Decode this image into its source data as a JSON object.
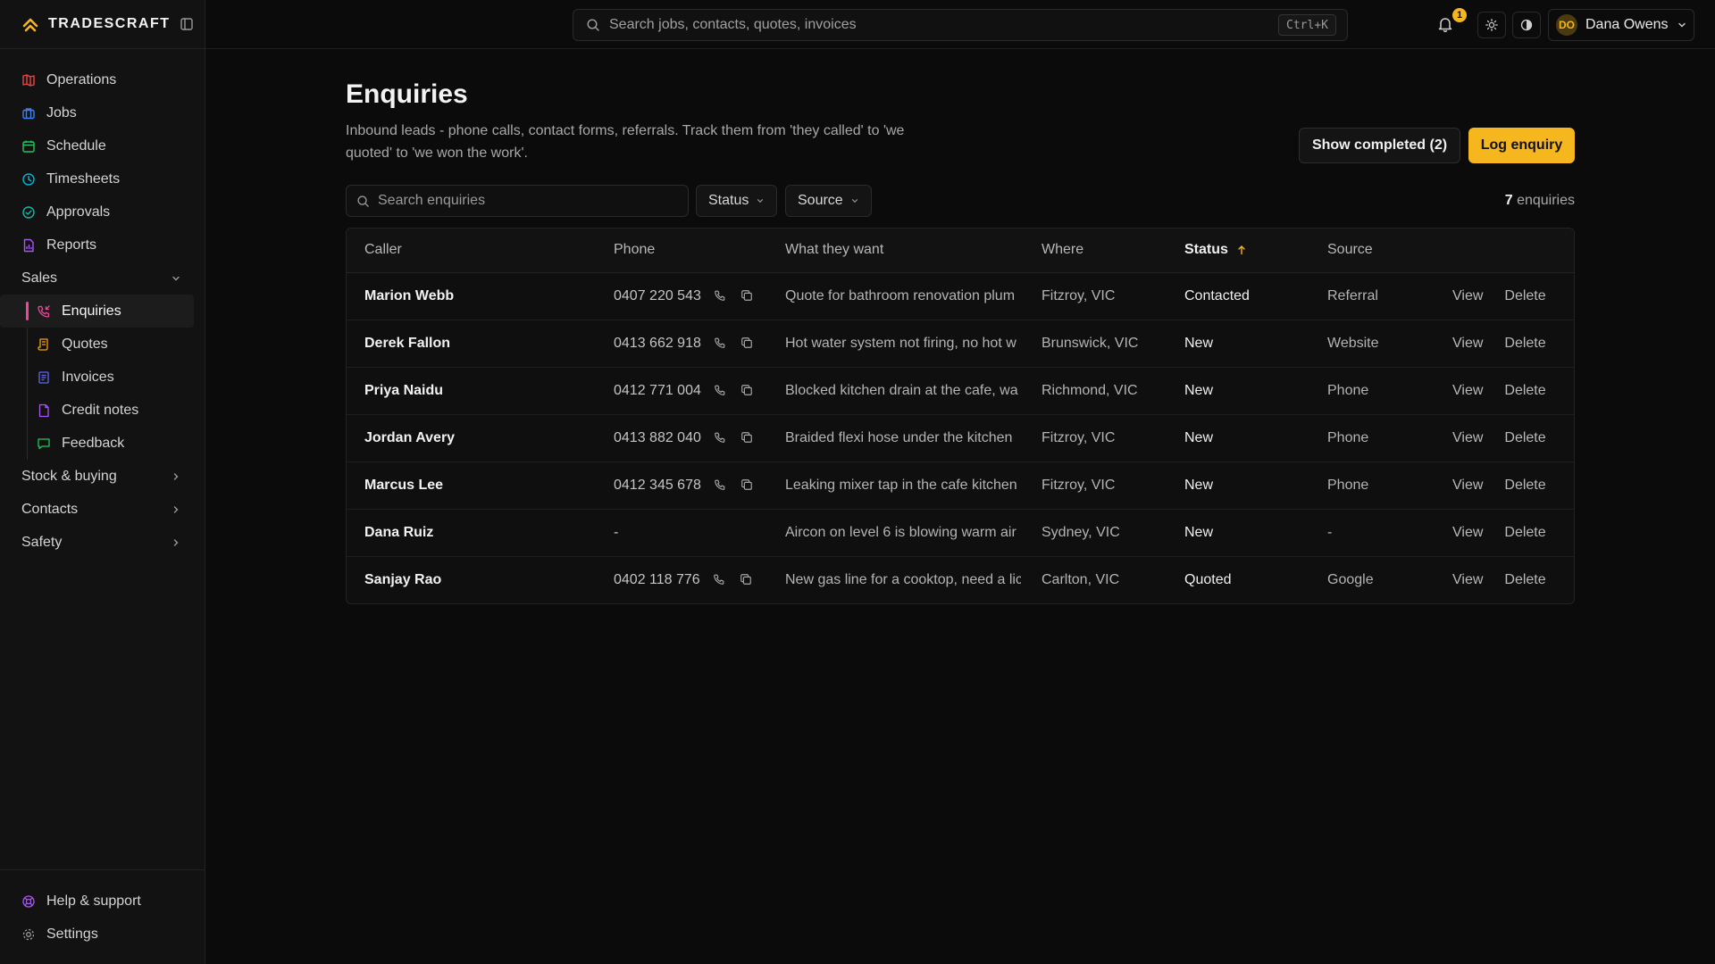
{
  "brand": {
    "name": "TRADESCRAFT"
  },
  "nav": {
    "items": [
      {
        "label": "Operations",
        "icon": "map-icon",
        "color": "#ef4444"
      },
      {
        "label": "Jobs",
        "icon": "briefcase-icon",
        "color": "#3b82f6"
      },
      {
        "label": "Schedule",
        "icon": "calendar-icon",
        "color": "#22c55e"
      },
      {
        "label": "Timesheets",
        "icon": "clock-icon",
        "color": "#06b6d4"
      },
      {
        "label": "Approvals",
        "icon": "check-circle-icon",
        "color": "#14b8a6"
      },
      {
        "label": "Reports",
        "icon": "file-chart-icon",
        "color": "#a855f7"
      }
    ],
    "sales": {
      "label": "Sales",
      "items": [
        {
          "label": "Enquiries",
          "icon": "phone-incoming-icon",
          "color": "#ec4899",
          "active": true
        },
        {
          "label": "Quotes",
          "icon": "scroll-icon",
          "color": "#f59e0b"
        },
        {
          "label": "Invoices",
          "icon": "receipt-icon",
          "color": "#6366f1"
        },
        {
          "label": "Credit notes",
          "icon": "file-icon",
          "color": "#a855f7"
        },
        {
          "label": "Feedback",
          "icon": "message-icon",
          "color": "#22c55e"
        }
      ]
    },
    "sections": [
      {
        "label": "Stock & buying"
      },
      {
        "label": "Contacts"
      },
      {
        "label": "Safety"
      }
    ],
    "bottom": [
      {
        "label": "Help & support",
        "icon": "lifebuoy-icon"
      },
      {
        "label": "Settings",
        "icon": "gear-icon"
      }
    ]
  },
  "topbar": {
    "search_placeholder": "Search jobs, contacts, quotes, invoices",
    "shortcut": "Ctrl+K",
    "notifications_count": "1",
    "user": {
      "initials": "DO",
      "name": "Dana Owens"
    }
  },
  "page": {
    "title": "Enquiries",
    "description": "Inbound leads - phone calls, contact forms, referrals. Track them from 'they called' to 'we quoted' to 'we won the work'.",
    "show_completed_label": "Show completed (2)",
    "log_enquiry_label": "Log enquiry",
    "search_placeholder": "Search enquiries",
    "filters": {
      "status": "Status",
      "source": "Source"
    },
    "count_number": "7",
    "count_suffix": " enquiries"
  },
  "table": {
    "columns": [
      "Caller",
      "Phone",
      "What they want",
      "Where",
      "Status",
      "Source"
    ],
    "sorted_column": "Status",
    "actions": {
      "view": "View",
      "delete": "Delete"
    },
    "rows": [
      {
        "caller": "Marion Webb",
        "phone": "0407 220 543",
        "want": "Quote for bathroom renovation plum",
        "where": "Fitzroy, VIC",
        "status": "Contacted",
        "source": "Referral"
      },
      {
        "caller": "Derek Fallon",
        "phone": "0413 662 918",
        "want": "Hot water system not firing, no hot w",
        "where": "Brunswick, VIC",
        "status": "New",
        "source": "Website"
      },
      {
        "caller": "Priya Naidu",
        "phone": "0412 771 004",
        "want": "Blocked kitchen drain at the cafe, wa",
        "where": "Richmond, VIC",
        "status": "New",
        "source": "Phone"
      },
      {
        "caller": "Jordan Avery",
        "phone": "0413 882 040",
        "want": "Braided flexi hose under the kitchen",
        "where": "Fitzroy, VIC",
        "status": "New",
        "source": "Phone"
      },
      {
        "caller": "Marcus Lee",
        "phone": "0412 345 678",
        "want": "Leaking mixer tap in the cafe kitchen",
        "where": "Fitzroy, VIC",
        "status": "New",
        "source": "Phone"
      },
      {
        "caller": "Dana Ruiz",
        "phone": "-",
        "want": "Aircon on level 6 is blowing warm air",
        "where": "Sydney, VIC",
        "status": "New",
        "source": "-"
      },
      {
        "caller": "Sanjay Rao",
        "phone": "0402 118 776",
        "want": "New gas line for a cooktop, need a lic",
        "where": "Carlton, VIC",
        "status": "Quoted",
        "source": "Google"
      }
    ]
  },
  "colors": {
    "accent": "#f5b61e",
    "active_marker": "#ec4899"
  }
}
